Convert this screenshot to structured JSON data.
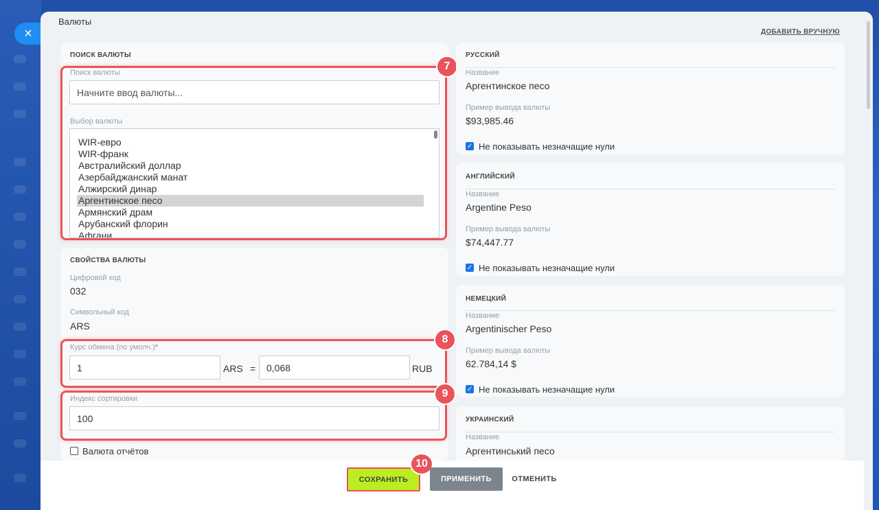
{
  "panel": {
    "title": "Валюты",
    "add_manually": "ДОБАВИТЬ ВРУЧНУЮ",
    "close_icon": "×"
  },
  "search": {
    "heading": "ПОИСК ВАЛЮТЫ",
    "search_label": "Поиск валюты",
    "search_placeholder": "Начните ввод валюты...",
    "select_label": "Выбор валюты",
    "options": [
      "WIR-евро",
      "WIR-франк",
      "Австралийский доллар",
      "Азербайджанский манат",
      "Алжирский динар",
      "Аргентинское песо",
      "Армянский драм",
      "Арубанский флорин",
      "Афгани"
    ],
    "selected_index": 5
  },
  "props": {
    "heading": "СВОЙСТВА ВАЛЮТЫ",
    "num_code_label": "Цифровой код",
    "num_code": "032",
    "sym_code_label": "Символьный код",
    "sym_code": "ARS",
    "rate_label": "Курс обмена (по умолч.)",
    "rate_required": "*",
    "rate_amount": "1",
    "rate_from": "ARS",
    "rate_eq": "=",
    "rate_value": "0,068",
    "rate_to": "RUB",
    "sort_label": "Индекс сортировки",
    "sort_value": "100",
    "report_currency_label": "Валюта отчётов"
  },
  "languages": [
    {
      "heading": "РУССКИЙ",
      "name_label": "Название",
      "name": "Аргентинское песо",
      "example_label": "Пример вывода валюты",
      "example": "$93,985.46",
      "hide_zeros_label": "Не показывать незначащие нули"
    },
    {
      "heading": "АНГЛИЙСКИЙ",
      "name_label": "Название",
      "name": "Argentine Peso",
      "example_label": "Пример вывода валюты",
      "example": "$74,447.77",
      "hide_zeros_label": "Не показывать незначащие нули"
    },
    {
      "heading": "НЕМЕЦКИЙ",
      "name_label": "Название",
      "name": "Argentinischer Peso",
      "example_label": "Пример вывода валюты",
      "example": "62.784,14 $",
      "hide_zeros_label": "Не показывать незначащие нули"
    },
    {
      "heading": "УКРАИНСКИЙ",
      "name_label": "Название",
      "name": "Аргентинський песо"
    }
  ],
  "badges": [
    "7",
    "8",
    "9",
    "10"
  ],
  "footer": {
    "save": "СОХРАНИТЬ",
    "apply": "ПРИМЕНИТЬ",
    "cancel": "ОТМЕНИТЬ"
  },
  "colors": {
    "accent": "#bbed21",
    "highlight": "#e9535a",
    "checkbox": "#1a73e8"
  }
}
